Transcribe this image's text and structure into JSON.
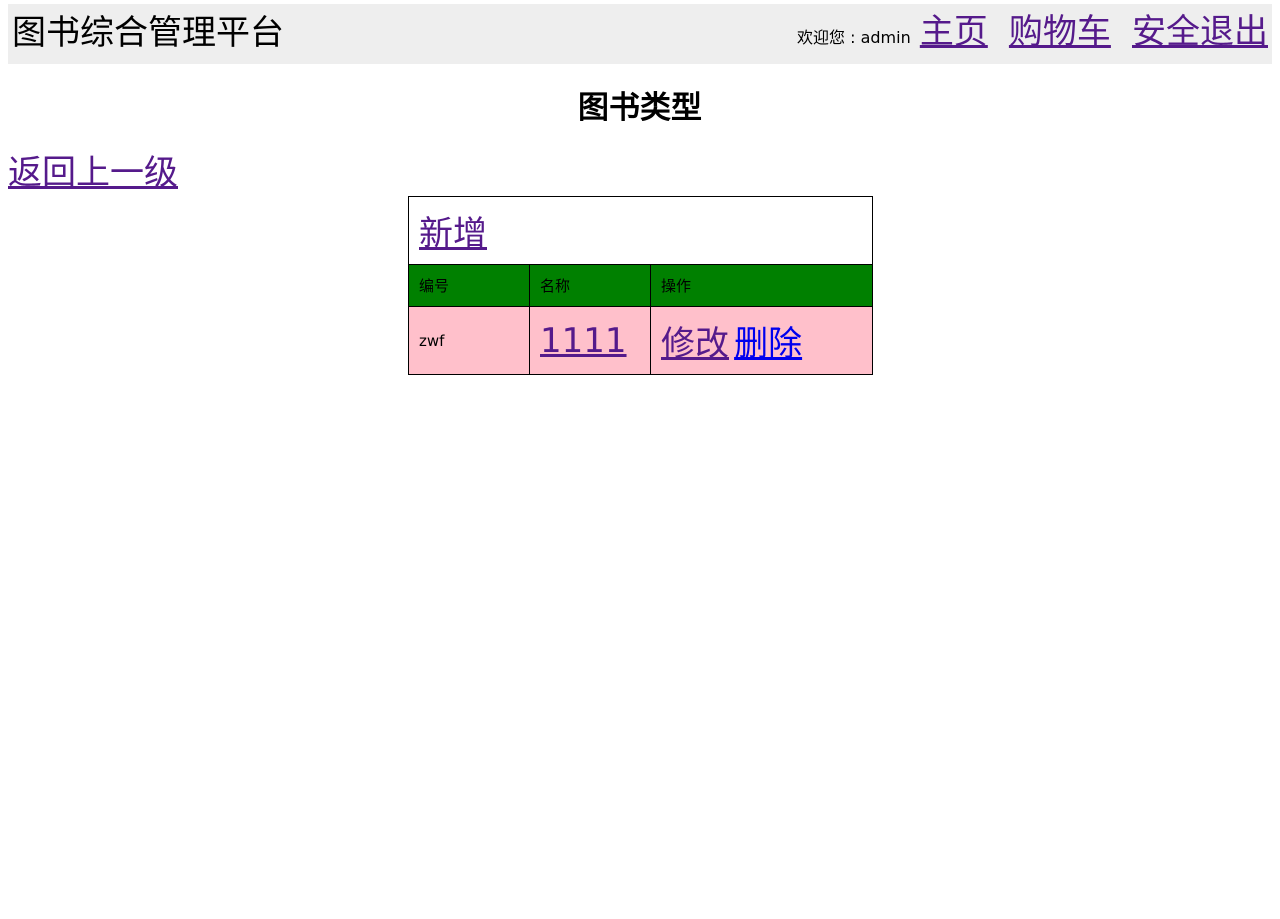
{
  "header": {
    "title": "图书综合管理平台",
    "welcome": "欢迎您 : admin",
    "nav": [
      {
        "label": "主页"
      },
      {
        "label": "购物车"
      },
      {
        "label": "安全退出"
      }
    ]
  },
  "page": {
    "heading": "图书类型",
    "back_link": "返回上一级"
  },
  "table": {
    "add_link": "新增",
    "columns": [
      "编号",
      "名称",
      "操作"
    ],
    "rows": [
      {
        "id": "zwf",
        "name": "1111",
        "edit": "修改",
        "delete": "删除"
      }
    ]
  },
  "colors": {
    "header_bg": "#eeeeee",
    "column_header_bg": "#008000",
    "row_bg": "#ffc0cb",
    "visited_link": "#551a8b",
    "link": "#0000ee"
  }
}
